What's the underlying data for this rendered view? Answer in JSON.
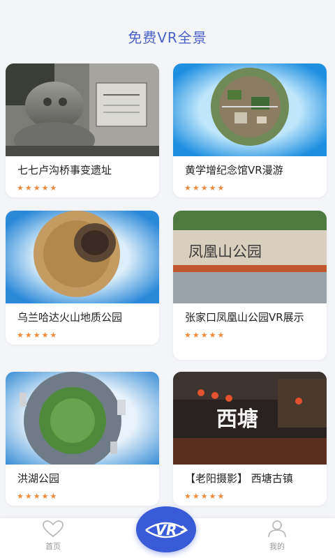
{
  "header": {
    "title": "免费VR全景"
  },
  "cards": [
    {
      "name": "七七卢沟桥事变遗址",
      "rating": 5
    },
    {
      "name": "黄学增纪念馆VR漫游",
      "rating": 5
    },
    {
      "name": "乌兰哈达火山地质公园",
      "rating": 5
    },
    {
      "name": "张家口凤凰山公园VR展示",
      "rating": 5,
      "thumb_text": "凤凰山公园"
    },
    {
      "name": "洪湖公园",
      "rating": 5
    },
    {
      "name": "【老阳摄影】 西塘古镇",
      "rating": 5,
      "thumb_text": "西塘"
    }
  ],
  "tabbar": {
    "home_label": "首页",
    "vr_label": "VR",
    "me_label": "我的"
  },
  "colors": {
    "accent": "#3a5bd8",
    "title": "#4a63c9",
    "star": "#f08a3a"
  }
}
